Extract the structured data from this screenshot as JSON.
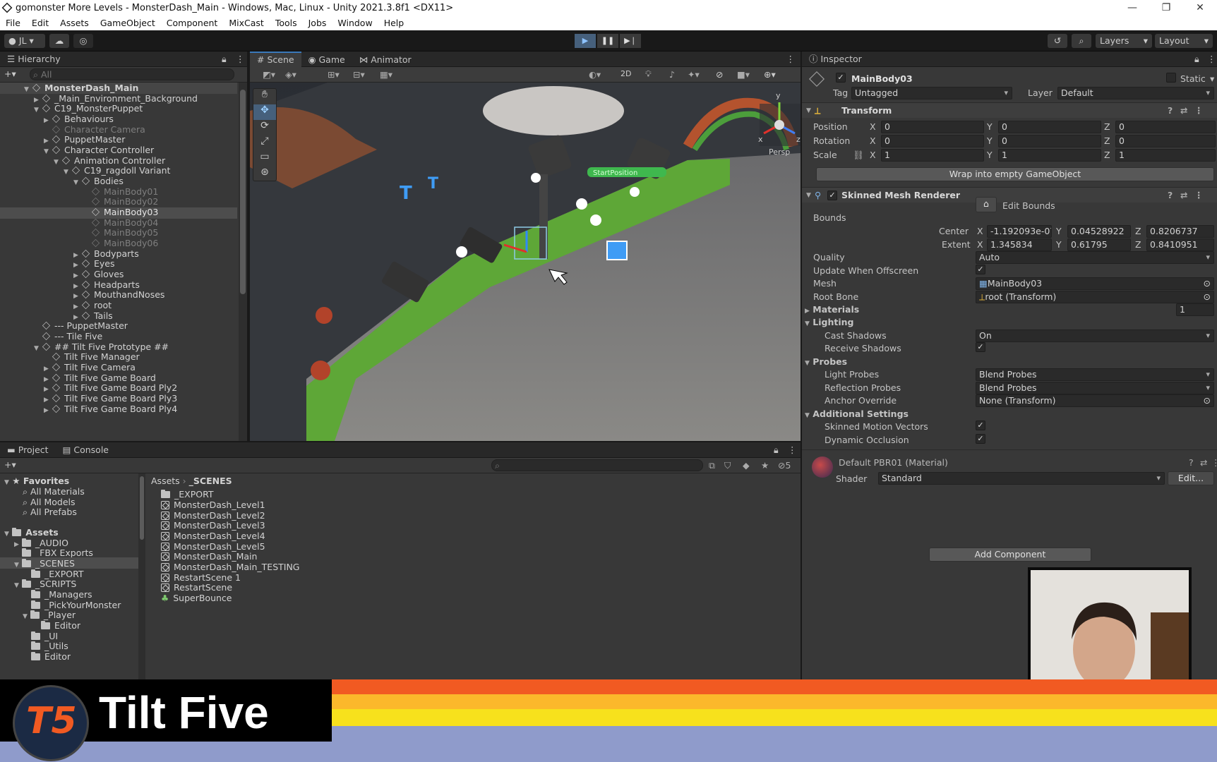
{
  "window": {
    "title": "gomonster More Levels - MonsterDash_Main - Windows, Mac, Linux - Unity 2021.3.8f1 <DX11>"
  },
  "menu": [
    "File",
    "Edit",
    "Assets",
    "GameObject",
    "Component",
    "MixCast",
    "Tools",
    "Jobs",
    "Window",
    "Help"
  ],
  "toolbar": {
    "account": "JL",
    "layers": "Layers",
    "layout": "Layout"
  },
  "hierarchy": {
    "title": "Hierarchy",
    "search_placeholder": "All",
    "items": [
      {
        "label": "MonsterDash_Main"
      },
      {
        "label": "_Main_Environment_Background"
      },
      {
        "label": "C19_MonsterPuppet"
      },
      {
        "label": "Behaviours"
      },
      {
        "label": "Character Camera"
      },
      {
        "label": "PuppetMaster"
      },
      {
        "label": "Character Controller"
      },
      {
        "label": "Animation Controller"
      },
      {
        "label": "C19_ragdoll Variant"
      },
      {
        "label": "Bodies"
      },
      {
        "label": "MainBody01"
      },
      {
        "label": "MainBody02"
      },
      {
        "label": "MainBody03"
      },
      {
        "label": "MainBody04"
      },
      {
        "label": "MainBody05"
      },
      {
        "label": "MainBody06"
      },
      {
        "label": "Bodyparts"
      },
      {
        "label": "Eyes"
      },
      {
        "label": "Gloves"
      },
      {
        "label": "Headparts"
      },
      {
        "label": "MouthandNoses"
      },
      {
        "label": "root"
      },
      {
        "label": "Tails"
      },
      {
        "label": "--- PuppetMaster"
      },
      {
        "label": "--- Tile Five"
      },
      {
        "label": "## Tilt Five Prototype ##"
      },
      {
        "label": "Tilt Five Manager"
      },
      {
        "label": "Tilt Five Camera"
      },
      {
        "label": "Tilt Five Game Board"
      },
      {
        "label": "Tilt Five Game Board Ply2"
      },
      {
        "label": "Tilt Five Game Board Ply3"
      },
      {
        "label": "Tilt Five Game Board Ply4"
      }
    ]
  },
  "scene_tabs": [
    "Scene",
    "Game",
    "Animator"
  ],
  "scene": {
    "mode_2d": "2D",
    "gizmo_label": "Persp",
    "axis_y": "y",
    "axis_x": "x",
    "axis_z": "z",
    "tag_text": "StartPosition"
  },
  "inspector": {
    "title": "Inspector",
    "object_name": "MainBody03",
    "static_label": "Static",
    "tag_label": "Tag",
    "tag_value": "Untagged",
    "layer_label": "Layer",
    "layer_value": "Default",
    "transform": {
      "title": "Transform",
      "position_label": "Position",
      "rotation_label": "Rotation",
      "scale_label": "Scale",
      "position": [
        "0",
        "0",
        "0"
      ],
      "rotation": [
        "0",
        "0",
        "0"
      ],
      "scale": [
        "1",
        "1",
        "1"
      ],
      "wrap_button": "Wrap into empty GameObject"
    },
    "axes": [
      "X",
      "Y",
      "Z"
    ],
    "smr": {
      "title": "Skinned Mesh Renderer",
      "edit_bounds": "Edit Bounds",
      "bounds_label": "Bounds",
      "center_label": "Center",
      "extent_label": "Extent",
      "center": [
        "-1.192093e-07",
        "0.04528922",
        "0.8206737"
      ],
      "extent": [
        "1.345834",
        "0.61795",
        "0.8410951"
      ],
      "quality_label": "Quality",
      "quality_value": "Auto",
      "update_offscreen_label": "Update When Offscreen",
      "mesh_label": "Mesh",
      "mesh_value": "MainBody03",
      "root_bone_label": "Root Bone",
      "root_bone_value": "root (Transform)",
      "materials_label": "Materials",
      "materials_count": "1",
      "lighting_label": "Lighting",
      "cast_shadows_label": "Cast Shadows",
      "cast_shadows_value": "On",
      "receive_shadows_label": "Receive Shadows",
      "probes_label": "Probes",
      "light_probes_label": "Light Probes",
      "light_probes_value": "Blend Probes",
      "reflection_probes_label": "Reflection Probes",
      "reflection_probes_value": "Blend Probes",
      "anchor_override_label": "Anchor Override",
      "anchor_override_value": "None (Transform)",
      "additional_label": "Additional Settings",
      "skinned_motion_label": "Skinned Motion Vectors",
      "dynamic_occlusion_label": "Dynamic Occlusion"
    },
    "material": {
      "name": "Default PBR01 (Material)",
      "shader_label": "Shader",
      "shader_value": "Standard",
      "edit_button": "Edit..."
    },
    "add_component": "Add Component"
  },
  "project": {
    "tabs": [
      "Project",
      "Console"
    ],
    "favorites_label": "Favorites",
    "favorites": [
      "All Materials",
      "All Models",
      "All Prefabs"
    ],
    "assets_label": "Assets",
    "tree": [
      {
        "label": "_AUDIO"
      },
      {
        "label": "_FBX Exports"
      },
      {
        "label": "_SCENES"
      },
      {
        "label": "_EXPORT"
      },
      {
        "label": "_SCRIPTS"
      },
      {
        "label": "_Managers"
      },
      {
        "label": "_PickYourMonster"
      },
      {
        "label": "_Player"
      },
      {
        "label": "Editor"
      },
      {
        "label": "_UI"
      },
      {
        "label": "_Utils"
      },
      {
        "label": "Editor"
      }
    ],
    "breadcrumb": [
      "Assets",
      "_SCENES"
    ],
    "files": [
      "_EXPORT",
      "MonsterDash_Level1",
      "MonsterDash_Level2",
      "MonsterDash_Level3",
      "MonsterDash_Level4",
      "MonsterDash_Level5",
      "MonsterDash_Main",
      "MonsterDash_Main_TESTING",
      "RestartScene 1",
      "RestartScene",
      "SuperBounce"
    ],
    "hidden_count": "5"
  },
  "banner": {
    "brand": "Tilt Five",
    "logo_mark": "T5"
  },
  "colors": {
    "accent": "#3a79bb",
    "stripe_orange": "#f15a22",
    "stripe_yellow": "#f7e11c",
    "stripe_blue": "#8f9bcb",
    "grass": "#5ea737"
  }
}
